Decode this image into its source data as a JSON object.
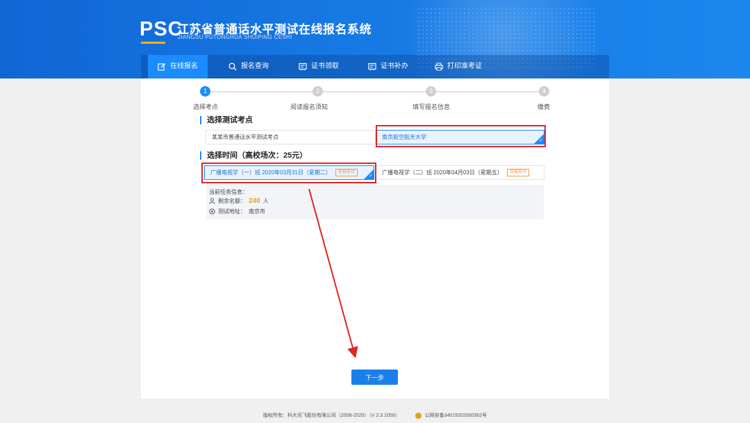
{
  "header": {
    "logo": "PSC",
    "title": "江苏省普通话水平测试在线报名系统",
    "subtitle": "JIANGSU PUTONGHUA SHUIPING CESHI"
  },
  "nav": {
    "items": [
      {
        "label": "在线报名",
        "icon": "edit-icon",
        "active": true
      },
      {
        "label": "报名查询",
        "icon": "search-icon"
      },
      {
        "label": "证书领取",
        "icon": "certificate-icon"
      },
      {
        "label": "证书补办",
        "icon": "certificate-icon"
      },
      {
        "label": "打印准考证",
        "icon": "printer-icon"
      }
    ]
  },
  "steps": [
    {
      "num": "1",
      "label": "选择考点",
      "active": true
    },
    {
      "num": "2",
      "label": "阅读报名须知"
    },
    {
      "num": "3",
      "label": "填写报名信息"
    },
    {
      "num": "4",
      "label": "缴费"
    }
  ],
  "site_section": {
    "title": "选择测试考点",
    "options": [
      "某某市普通话水平测试考点",
      "南京航空航天大学"
    ],
    "selected": 1
  },
  "time_section": {
    "title": "选择时间（高校场次：25元）",
    "options": [
      {
        "label": "广播电视学（一）班 2020年03月31日（星期二）",
        "tag": "在线支付"
      },
      {
        "label": "广播电视学（二）班 2020年04月03日（星期五）",
        "tag": "在线支付"
      }
    ],
    "selected": 0
  },
  "info": {
    "heading": "当前任务信息：",
    "remaining_label": "剩余名额：",
    "remaining_value": "240",
    "remaining_unit": "人",
    "address_label": "测试地址：",
    "address_value": "南京市"
  },
  "next_button": "下一步",
  "footer": {
    "copyright": "版权所有：科大讯飞股份有限公司（2008-2020）（V 2.3.1059）",
    "police": "公网安备34019202000362号"
  },
  "colors": {
    "accent": "#1a8cff",
    "annotation": "#e02424",
    "highlight": "#f39a1e"
  }
}
